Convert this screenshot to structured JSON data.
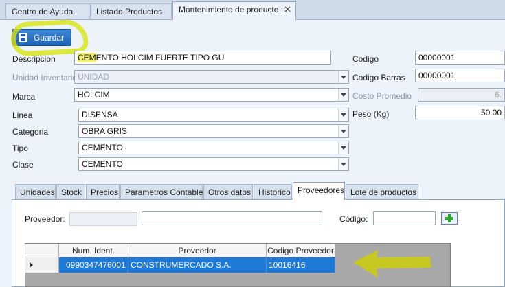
{
  "tabs": [
    {
      "label": "Centro de Ayuda."
    },
    {
      "label": "Listado Productos"
    },
    {
      "label": "Mantenimiento de producto ::."
    }
  ],
  "toolbar": {
    "save_label": "Guardar"
  },
  "form": {
    "descripcion": {
      "label": "Descripcion",
      "value_marked": "CEM",
      "value_rest": "ENTO HOLCIM FUERTE TIPO GU"
    },
    "unidad_inventario": {
      "label": "Unidad Inventario",
      "value": "UNIDAD"
    },
    "marca": {
      "label": "Marca",
      "value": "HOLCIM"
    },
    "linea": {
      "label": "Linea",
      "value": "DISENSA"
    },
    "categoria": {
      "label": "Categoria",
      "value": "OBRA GRIS"
    },
    "tipo": {
      "label": "Tipo",
      "value": "CEMENTO"
    },
    "clase": {
      "label": "Clase",
      "value": "CEMENTO"
    },
    "codigo": {
      "label": "Codigo",
      "value": "00000001"
    },
    "codigo_barras": {
      "label": "Codigo Barras",
      "value": "00000001"
    },
    "costo_promedio": {
      "label": "Costo Promedio",
      "value": "6."
    },
    "peso": {
      "label": "Peso (Kg)",
      "value": "50.00"
    }
  },
  "inner_tabs": [
    {
      "label": "Unidades"
    },
    {
      "label": "Stock"
    },
    {
      "label": "Precios"
    },
    {
      "label": "Parametros Contables"
    },
    {
      "label": "Otros datos"
    },
    {
      "label": "Historico"
    },
    {
      "label": "Proveedores"
    },
    {
      "label": "Lote de productos"
    }
  ],
  "proveedores": {
    "proveedor_label": "Proveedor:",
    "proveedor_code_value": "",
    "proveedor_name_value": "",
    "codigo_label": "Código:",
    "codigo_value": "",
    "grid": {
      "columns": [
        "Num. Ident.",
        "Proveedor",
        "Codigo Proveedor"
      ],
      "rows": [
        [
          "0990347476001",
          "CONSTRUMERCADO S.A.",
          "10016416"
        ]
      ]
    }
  },
  "colors": {
    "accent": "#1f64b7",
    "selection": "#1e7ad6",
    "highlighter": "#d7e412"
  },
  "icons": [
    "floppy-disk-icon",
    "close-icon",
    "chevron-down-icon",
    "add-icon",
    "row-pointer-icon"
  ]
}
